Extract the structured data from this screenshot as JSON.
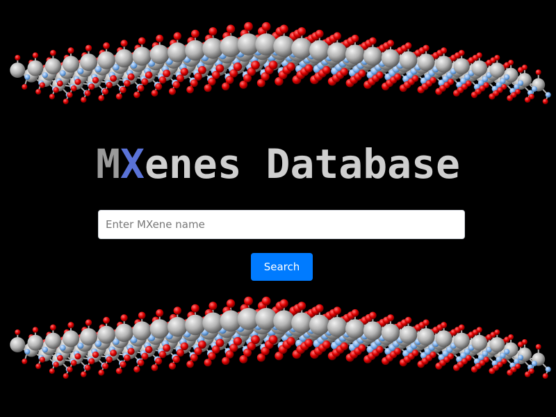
{
  "title": {
    "first_letter": "M",
    "accent_letter": "X",
    "rest": "enes Database"
  },
  "search": {
    "placeholder": "Enter MXene name",
    "value": "",
    "button_label": "Search"
  },
  "colors": {
    "background": "#000000",
    "title_m": "#9b9b9b",
    "title_x": "#5a73d8",
    "title_rest": "#cfcfcf",
    "button": "#007bff",
    "atom_metal": "#b4b4b4",
    "atom_oxygen": "#e00000",
    "atom_carbon_nitrogen": "#7fb2ee"
  },
  "decorations": {
    "top_illustration": "mxene-crystal-structure",
    "bottom_illustration": "mxene-crystal-structure"
  }
}
